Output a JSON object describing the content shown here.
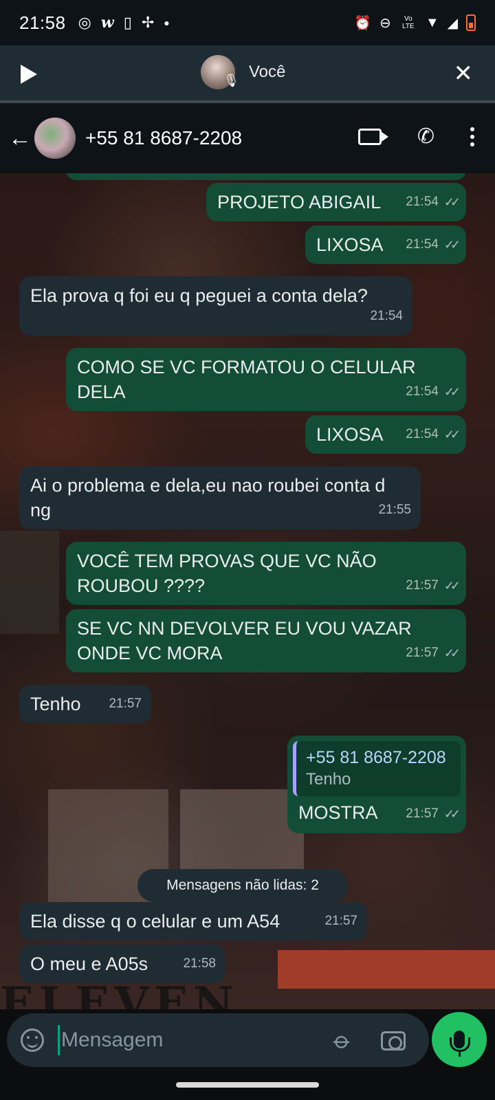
{
  "status_bar": {
    "time": "21:58",
    "left_icons": [
      "whatsapp-icon",
      "w-app-icon",
      "phone-outline-icon",
      "pinwheel-icon",
      "dot-icon"
    ],
    "right_icons": [
      "alarm-icon",
      "dnd-icon",
      "volte-icon",
      "wifi-icon",
      "signal-icon",
      "battery-low-icon"
    ],
    "volte_label": "Vo LTE"
  },
  "audio_player": {
    "name": "Você"
  },
  "chat_header": {
    "contact": "+55 81 8687-2208"
  },
  "messages": [
    {
      "dir": "out",
      "text": "PROJETO ABIGAIL",
      "time": "21:54",
      "ticks": "✓✓"
    },
    {
      "dir": "out",
      "text": "LIXOSA",
      "time": "21:54",
      "ticks": "✓✓"
    },
    {
      "dir": "in",
      "text": "Ela prova q foi eu q peguei a conta dela?",
      "time": "21:54"
    },
    {
      "dir": "out",
      "text": "COMO SE VC FORMATOU O CELULAR DELA",
      "time": "21:54",
      "ticks": "✓✓"
    },
    {
      "dir": "out",
      "text": "LIXOSA",
      "time": "21:54",
      "ticks": "✓✓"
    },
    {
      "dir": "in",
      "text": "Ai o problema e dela,eu nao roubei conta d ng",
      "time": "21:55"
    },
    {
      "dir": "out",
      "text": "VOCÊ TEM PROVAS QUE VC NÃO ROUBOU ????",
      "time": "21:57",
      "ticks": "✓✓"
    },
    {
      "dir": "out",
      "text": "SE VC NN DEVOLVER EU VOU VAZAR ONDE VC MORA",
      "time": "21:57",
      "ticks": "✓✓"
    },
    {
      "dir": "in",
      "text": "Tenho",
      "time": "21:57"
    },
    {
      "dir": "out",
      "text": "MOSTRA",
      "time": "21:57",
      "ticks": "✓✓",
      "quote_author": "+55 81 8687-2208",
      "quote_text": "Tenho"
    },
    {
      "dir": "in",
      "text": "Ela disse q o celular e um A54",
      "time": "21:57"
    },
    {
      "dir": "in",
      "text": "O meu e A05s",
      "time": "21:58"
    }
  ],
  "unread_divider": "Mensagens não lidas: 2",
  "input_bar": {
    "placeholder": "Mensagem"
  },
  "colors": {
    "outgoing_bubble": "#144d37",
    "incoming_bubble": "#1f2c33",
    "accent_green": "#21c063",
    "header_bg": "#0e1317"
  }
}
